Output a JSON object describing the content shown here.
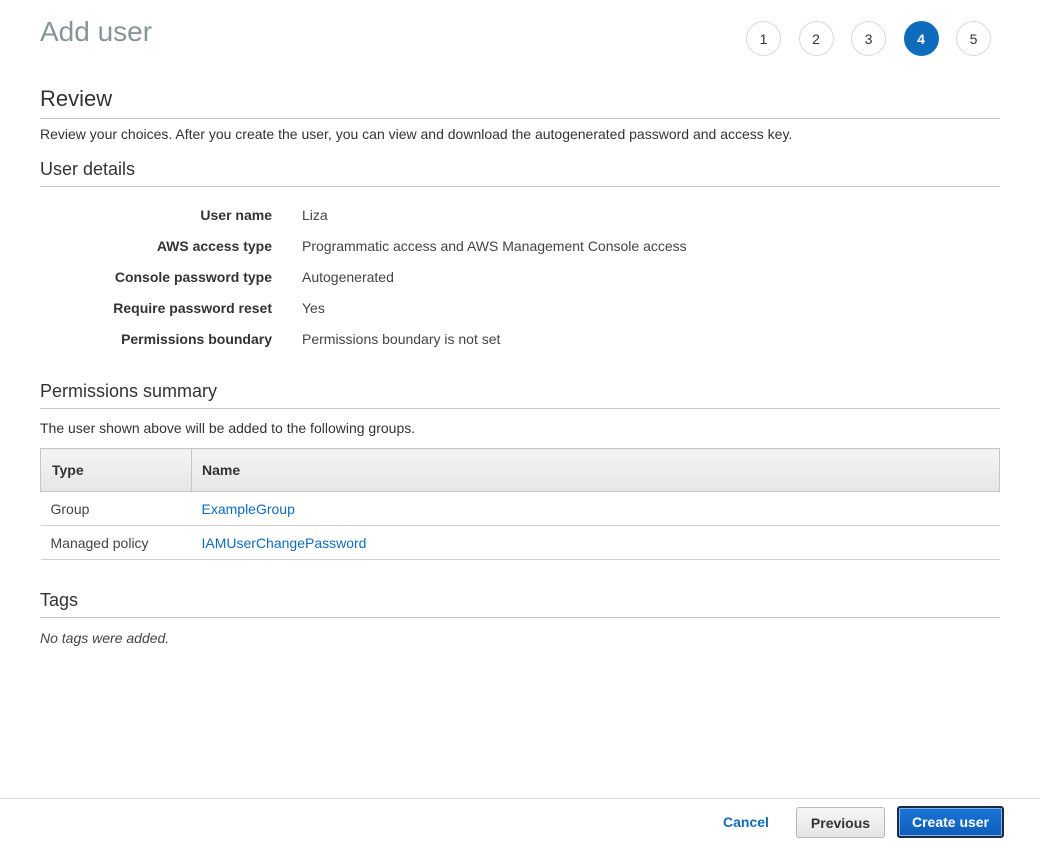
{
  "header": {
    "title": "Add user",
    "steps": [
      "1",
      "2",
      "3",
      "4",
      "5"
    ],
    "active_step": "4"
  },
  "review": {
    "heading": "Review",
    "description": "Review your choices. After you create the user, you can view and download the autogenerated password and access key."
  },
  "user_details": {
    "heading": "User details",
    "rows": [
      {
        "label": "User name",
        "value": "Liza"
      },
      {
        "label": "AWS access type",
        "value": "Programmatic access and AWS Management Console access"
      },
      {
        "label": "Console password type",
        "value": "Autogenerated"
      },
      {
        "label": "Require password reset",
        "value": "Yes"
      },
      {
        "label": "Permissions boundary",
        "value": "Permissions boundary is not set"
      }
    ]
  },
  "permissions": {
    "heading": "Permissions summary",
    "description": "The user shown above will be added to the following groups.",
    "columns": [
      "Type",
      "Name"
    ],
    "rows": [
      {
        "type": "Group",
        "name": "ExampleGroup"
      },
      {
        "type": "Managed policy",
        "name": "IAMUserChangePassword"
      }
    ]
  },
  "tags": {
    "heading": "Tags",
    "empty_text": "No tags were added."
  },
  "footer": {
    "cancel_label": "Cancel",
    "previous_label": "Previous",
    "create_label": "Create user"
  },
  "colors": {
    "accent": "#0f6cbd",
    "link": "#0f6cbd"
  }
}
